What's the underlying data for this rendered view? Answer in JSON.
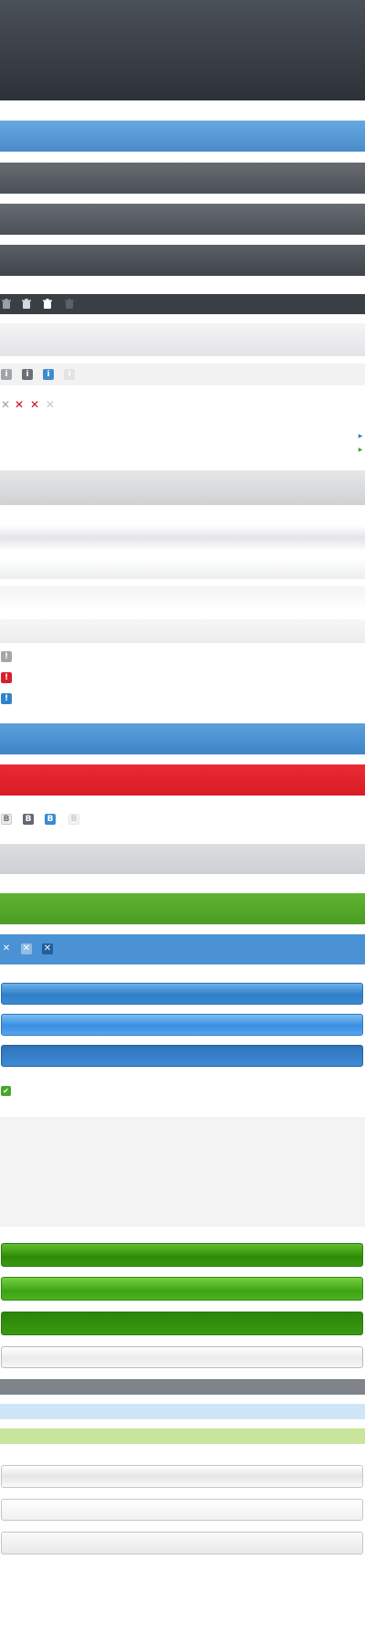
{
  "colors": {
    "dark_header_top": "#4a5058",
    "dark_header_bottom": "#2d3238",
    "blue_bar": "#4f93cf",
    "gray_bar": "#5a5f66",
    "red_bar": "#e0202c",
    "green_bar": "#52a827",
    "light_blue_strip": "#cfe6f8",
    "light_green_strip": "#c8e59b",
    "mid_gray_strip": "#7c8288"
  },
  "icons": {
    "trash_states": [
      "trash-icon",
      "trash-icon",
      "trash-icon",
      "trash-icon"
    ],
    "info_states": [
      "info-icon",
      "info-icon",
      "info-icon",
      "info-icon"
    ],
    "close_states": [
      "close-icon",
      "close-icon",
      "close-icon",
      "close-icon"
    ],
    "alert_states": [
      "alert-icon",
      "alert-icon",
      "alert-icon"
    ],
    "bold_states": [
      "bold-icon",
      "bold-icon",
      "bold-icon",
      "bold-icon"
    ],
    "close_box_states": [
      "close-icon",
      "close-icon",
      "close-icon"
    ],
    "check": "check-icon",
    "arrows": [
      "arrow-right-icon",
      "arrow-right-icon"
    ]
  },
  "glyphs": {
    "info": "i",
    "close": "✕",
    "alert": "!",
    "bold": "B",
    "check": "✔",
    "arrow": "▶"
  }
}
